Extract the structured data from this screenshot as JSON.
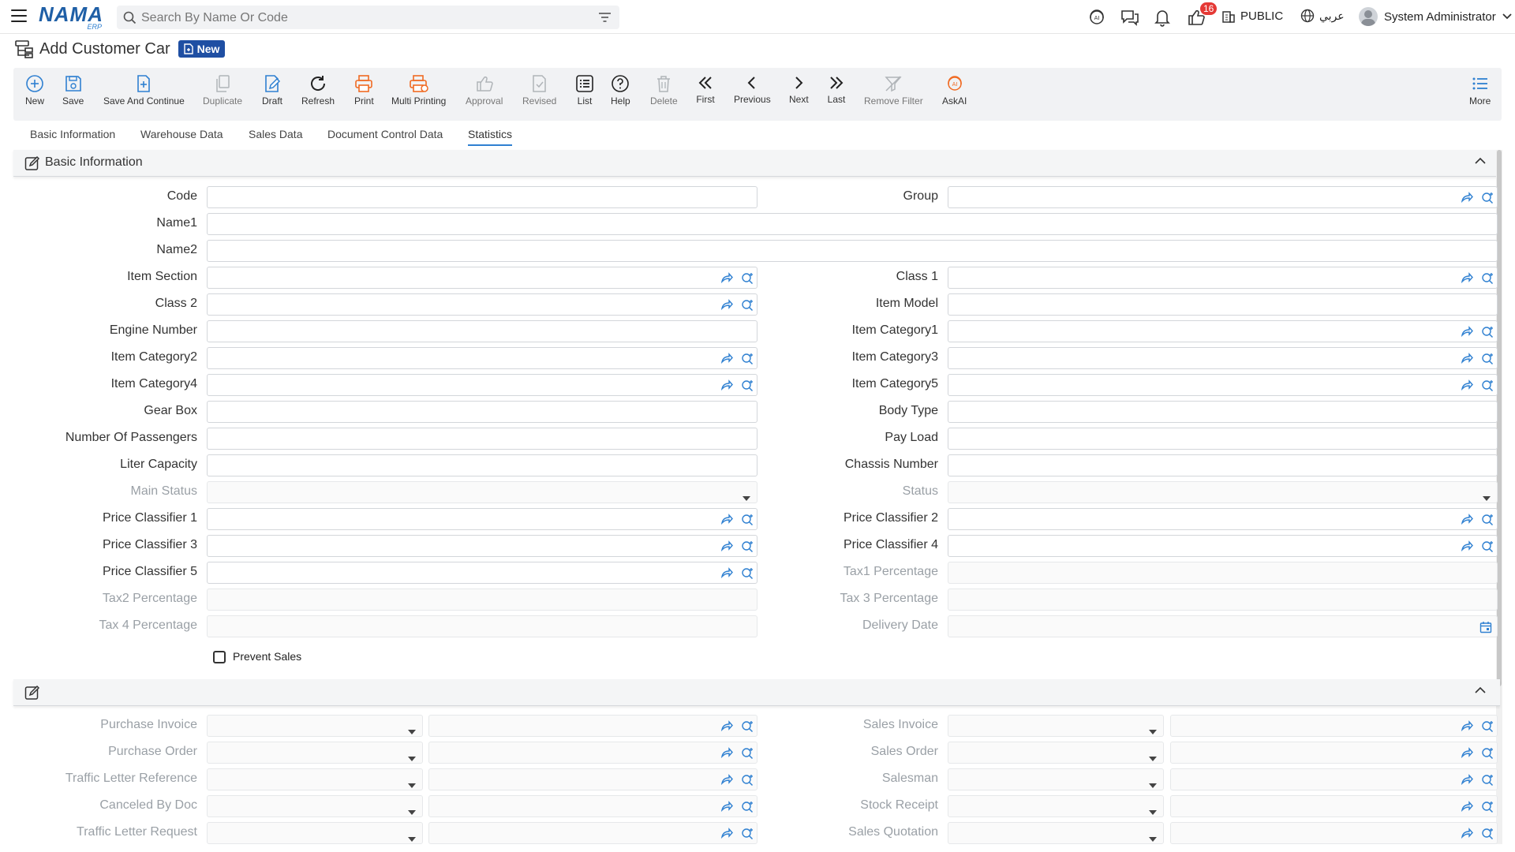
{
  "header": {
    "logo_text": "NAMA",
    "logo_sub": "ERP",
    "search_placeholder": "Search By Name Or Code",
    "notification_count": "16",
    "public_label": "PUBLIC",
    "language_label": "عربي",
    "user_name": "System Administrator"
  },
  "page": {
    "title": "Add Customer Car",
    "status_badge": "New"
  },
  "toolbar": [
    {
      "label": "New",
      "icon": "plus-circle-icon",
      "color": "#2f80d1"
    },
    {
      "label": "Save",
      "icon": "save-icon",
      "color": "#2f80d1"
    },
    {
      "label": "Save And Continue",
      "icon": "save-continue-icon",
      "color": "#2f80d1"
    },
    {
      "label": "Duplicate",
      "icon": "duplicate-icon",
      "color": "#b0b4b8"
    },
    {
      "label": "Draft",
      "icon": "draft-icon",
      "color": "#2f80d1"
    },
    {
      "label": "Refresh",
      "icon": "refresh-icon",
      "color": "#222222"
    },
    {
      "label": "Print",
      "icon": "print-icon",
      "color": "#f06a22"
    },
    {
      "label": "Multi Printing",
      "icon": "multi-print-icon",
      "color": "#f06a22"
    },
    {
      "label": "Approval",
      "icon": "approval-icon",
      "color": "#b0b4b8"
    },
    {
      "label": "Revised",
      "icon": "revised-icon",
      "color": "#b0b4b8"
    },
    {
      "label": "List",
      "icon": "list-icon",
      "color": "#222222"
    },
    {
      "label": "Help",
      "icon": "help-icon",
      "color": "#222222"
    },
    {
      "label": "Delete",
      "icon": "delete-icon",
      "color": "#b0b4b8"
    },
    {
      "label": "First",
      "icon": "first-icon",
      "color": "#222222"
    },
    {
      "label": "Previous",
      "icon": "previous-icon",
      "color": "#222222"
    },
    {
      "label": "Next",
      "icon": "next-icon",
      "color": "#222222"
    },
    {
      "label": "Last",
      "icon": "last-icon",
      "color": "#222222"
    },
    {
      "label": "Remove Filter",
      "icon": "remove-filter-icon",
      "color": "#b0b4b8"
    },
    {
      "label": "AskAI",
      "icon": "ask-ai-icon",
      "color": "#f06a22"
    },
    {
      "label": "More",
      "icon": "more-icon",
      "color": "#2f80d1"
    }
  ],
  "tabs": [
    "Basic Information",
    "Warehouse Data",
    "Sales Data",
    "Document Control Data",
    "Statistics"
  ],
  "active_tab": "Statistics",
  "section1": {
    "title": "Basic Information"
  },
  "fields": {
    "code": "Code",
    "group": "Group",
    "name1": "Name1",
    "name2": "Name2",
    "item_section": "Item Section",
    "class1": "Class 1",
    "class2": "Class 2",
    "item_model": "Item Model",
    "engine_number": "Engine Number",
    "item_category1": "Item Category1",
    "item_category2": "Item Category2",
    "item_category3": "Item Category3",
    "item_category4": "Item Category4",
    "item_category5": "Item Category5",
    "gear_box": "Gear Box",
    "body_type": "Body Type",
    "number_of_passengers": "Number Of Passengers",
    "pay_load": "Pay Load",
    "liter_capacity": "Liter Capacity",
    "chassis_number": "Chassis Number",
    "main_status": "Main Status",
    "status": "Status",
    "price_classifier_1": "Price Classifier 1",
    "price_classifier_2": "Price Classifier 2",
    "price_classifier_3": "Price Classifier 3",
    "price_classifier_4": "Price Classifier 4",
    "price_classifier_5": "Price Classifier 5",
    "tax1_percentage": "Tax1 Percentage",
    "tax2_percentage": "Tax2 Percentage",
    "tax3_percentage": "Tax 3 Percentage",
    "tax4_percentage": "Tax 4 Percentage",
    "delivery_date": "Delivery Date",
    "prevent_sales": "Prevent Sales"
  },
  "section2": {
    "left": [
      "Purchase Invoice",
      "Purchase Order",
      "Traffic Letter Reference",
      "Canceled By Doc",
      "Traffic Letter Request"
    ],
    "right": [
      "Sales Invoice",
      "Sales Order",
      "Salesman",
      "Stock Receipt",
      "Sales Quotation"
    ]
  }
}
